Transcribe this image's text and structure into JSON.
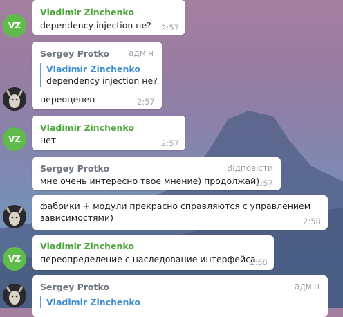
{
  "colors": {
    "vz_accent": "#4fa83d",
    "vz_avatar": "#5fbb4a",
    "quote_accent": "#3f8fd0",
    "bubble_bg": "#ffffff",
    "time": "#a3a9b1"
  },
  "users": {
    "vz": {
      "name": "Vladimir Zinchenko",
      "initials": "VZ"
    },
    "sp": {
      "name": "Sergey Protko",
      "role": "адмін"
    }
  },
  "reply_label": "Відповісти",
  "messages": [
    {
      "author": "Vladimir Zinchenko",
      "text": "dependency injection не?",
      "time": "2:57"
    },
    {
      "author": "Sergey Protko",
      "role": "адмін",
      "quote": {
        "author": "Vladimir Zinchenko",
        "text": "dependency injection не?"
      },
      "text": "переоценен",
      "time": "2:57"
    },
    {
      "author": "Vladimir Zinchenko",
      "text": "нет",
      "time": "2:57"
    },
    {
      "author": "Sergey Protko",
      "text": "мне очень интересно твое мнение) продолжай)",
      "time": "2:57"
    },
    {
      "text_lines": [
        "фабрики + модули прекрасно справляются с управлением",
        "зависимостями)"
      ],
      "time": "2:58"
    },
    {
      "author": "Vladimir Zinchenko",
      "text": "переопределение  с наследование интерфейса",
      "time": "2:58"
    },
    {
      "author": "Sergey Protko",
      "role": "адмін",
      "quote": {
        "author": "Vladimir Zinchenko"
      }
    }
  ]
}
